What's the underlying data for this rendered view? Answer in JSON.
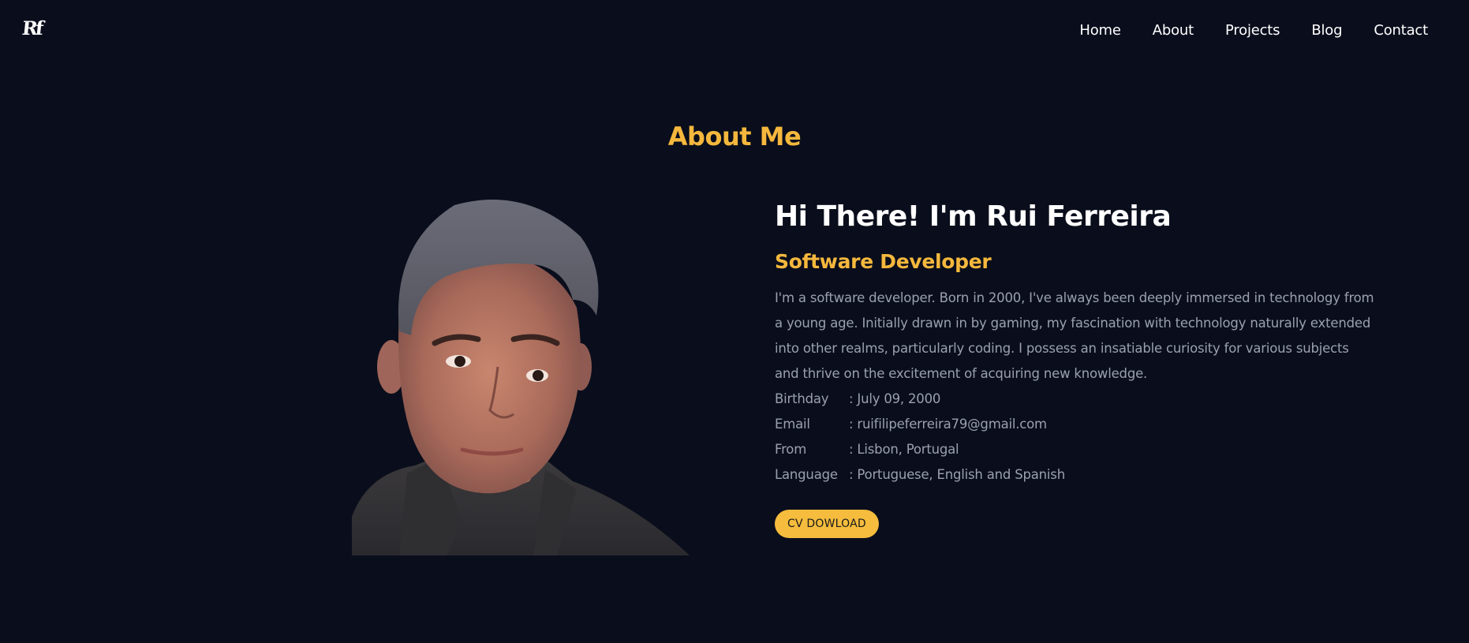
{
  "logo": {
    "text": "Rf"
  },
  "nav": {
    "items": [
      "Home",
      "About",
      "Projects",
      "Blog",
      "Contact"
    ]
  },
  "section": {
    "title": "About Me"
  },
  "about": {
    "greeting": "Hi There! I'm Rui Ferreira",
    "role": "Software Developer",
    "bio": "I'm a software developer. Born in 2000, I've always been deeply immersed in technology from a young age. Initially drawn in by gaming, my fascination with technology naturally extended into other realms, particularly coding. I possess an insatiable curiosity for various subjects and thrive on the excitement of acquiring new knowledge.",
    "details": [
      {
        "label": "Birthday",
        "value": ": July 09, 2000"
      },
      {
        "label": "Email",
        "value": ": ruifilipeferreira79@gmail.com"
      },
      {
        "label": "From",
        "value": ": Lisbon, Portugal"
      },
      {
        "label": "Language",
        "value": ": Portuguese, English and Spanish"
      }
    ],
    "cv_button": "CV DOWLOAD"
  },
  "colors": {
    "background": "#0a0e1c",
    "accent": "#f5b83d",
    "text": "#ffffff",
    "muted": "#9aa0ad"
  }
}
